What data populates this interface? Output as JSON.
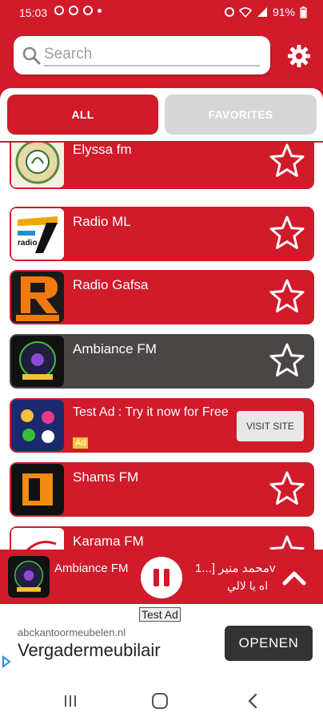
{
  "status": {
    "time": "15:03",
    "battery": "91%"
  },
  "search": {
    "placeholder": "Search"
  },
  "tabs": {
    "all": "ALL",
    "favorites": "FAVORITES"
  },
  "stations": [
    {
      "name": "Elyssa fm"
    },
    {
      "name": "Radio ML"
    },
    {
      "name": "Radio Gafsa"
    },
    {
      "name": "Ambiance FM"
    }
  ],
  "ad_item": {
    "text": "Test Ad : Try it now for Free",
    "badge": "Ad",
    "button": "VISIT SITE"
  },
  "stations2": [
    {
      "name": "Shams FM"
    },
    {
      "name": "Karama FM"
    }
  ],
  "player": {
    "station": "Ambiance FM",
    "track_line1": "محمد منير [...1v",
    "track_line2": "اه يا لالي"
  },
  "banner_ad": {
    "label": "Test Ad",
    "url": "abckantoormeubelen.nl",
    "headline": "Vergadermeubilair",
    "button": "OPENEN"
  },
  "colors": {
    "primary": "#d11a2a",
    "active_item": "#4b4646",
    "tab_inactive": "#d6d6d6"
  }
}
